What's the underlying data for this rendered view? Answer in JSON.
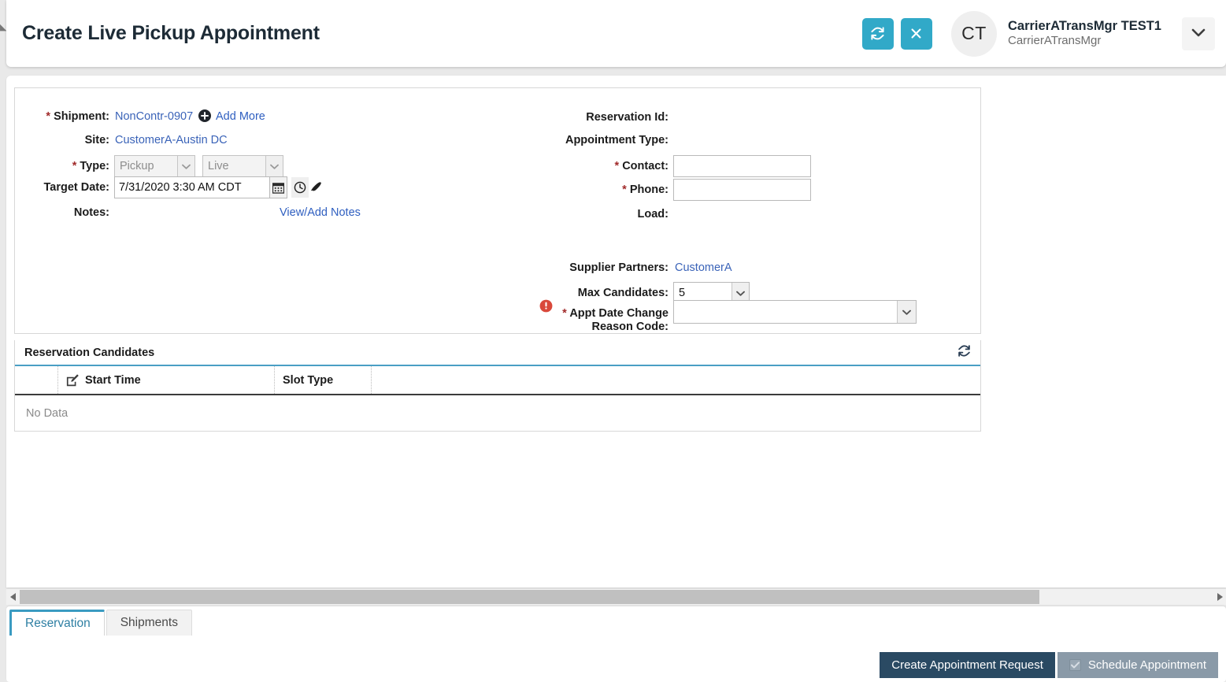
{
  "header": {
    "title": "Create Live Pickup Appointment",
    "refresh_icon": "refresh-icon",
    "close_icon": "close-icon",
    "avatar_initials": "CT",
    "user_name": "CarrierATransMgr TEST1",
    "user_role": "CarrierATransMgr",
    "caret_icon": "chevron-down-icon",
    "accent_color": "#31a9c8"
  },
  "form": {
    "left": {
      "shipment_label": "Shipment:",
      "shipment_value": "NonContr-0907",
      "add_more_label": "Add More",
      "site_label": "Site:",
      "site_value": "CustomerA-Austin DC",
      "type_label": "Type:",
      "type_value": "Pickup",
      "type2_value": "Live",
      "target_date_label": "Target Date:",
      "target_date_value": "7/31/2020 3:30 AM CDT",
      "notes_label": "Notes:",
      "view_add_notes_label": "View/Add Notes"
    },
    "right": {
      "reservation_id_label": "Reservation Id:",
      "reservation_id_value": "",
      "appointment_type_label": "Appointment Type:",
      "appointment_type_value": "",
      "contact_label": "Contact:",
      "contact_value": "",
      "phone_label": "Phone:",
      "phone_value": "",
      "load_label": "Load:",
      "load_value": "",
      "supplier_partners_label": "Supplier Partners:",
      "supplier_partners_value": "CustomerA",
      "max_candidates_label": "Max Candidates:",
      "max_candidates_value": "5",
      "reason_code_label_line1": "Appt Date Change",
      "reason_code_label_line2": "Reason Code:",
      "reason_code_value": "",
      "error_color": "#d9483b"
    }
  },
  "panel": {
    "title": "Reservation Candidates",
    "refresh_icon": "refresh-icon",
    "columns": [
      "",
      "Start Time",
      "Slot Type",
      ""
    ],
    "edit_icon": "edit-icon",
    "empty_text": "No Data",
    "accent_color": "#4a9fc4"
  },
  "tabs": [
    {
      "label": "Reservation",
      "active": true
    },
    {
      "label": "Shipments",
      "active": false
    }
  ],
  "actions": {
    "primary_label": "Create Appointment Request",
    "primary_color": "#2a4a63",
    "secondary_label": "Schedule Appointment",
    "secondary_color": "#8a9aa8",
    "secondary_checkbox_icon": "checkbox-checked-icon"
  },
  "scrollbar": {
    "left_arrow_icon": "triangle-left-icon",
    "right_arrow_icon": "triangle-right-icon"
  }
}
